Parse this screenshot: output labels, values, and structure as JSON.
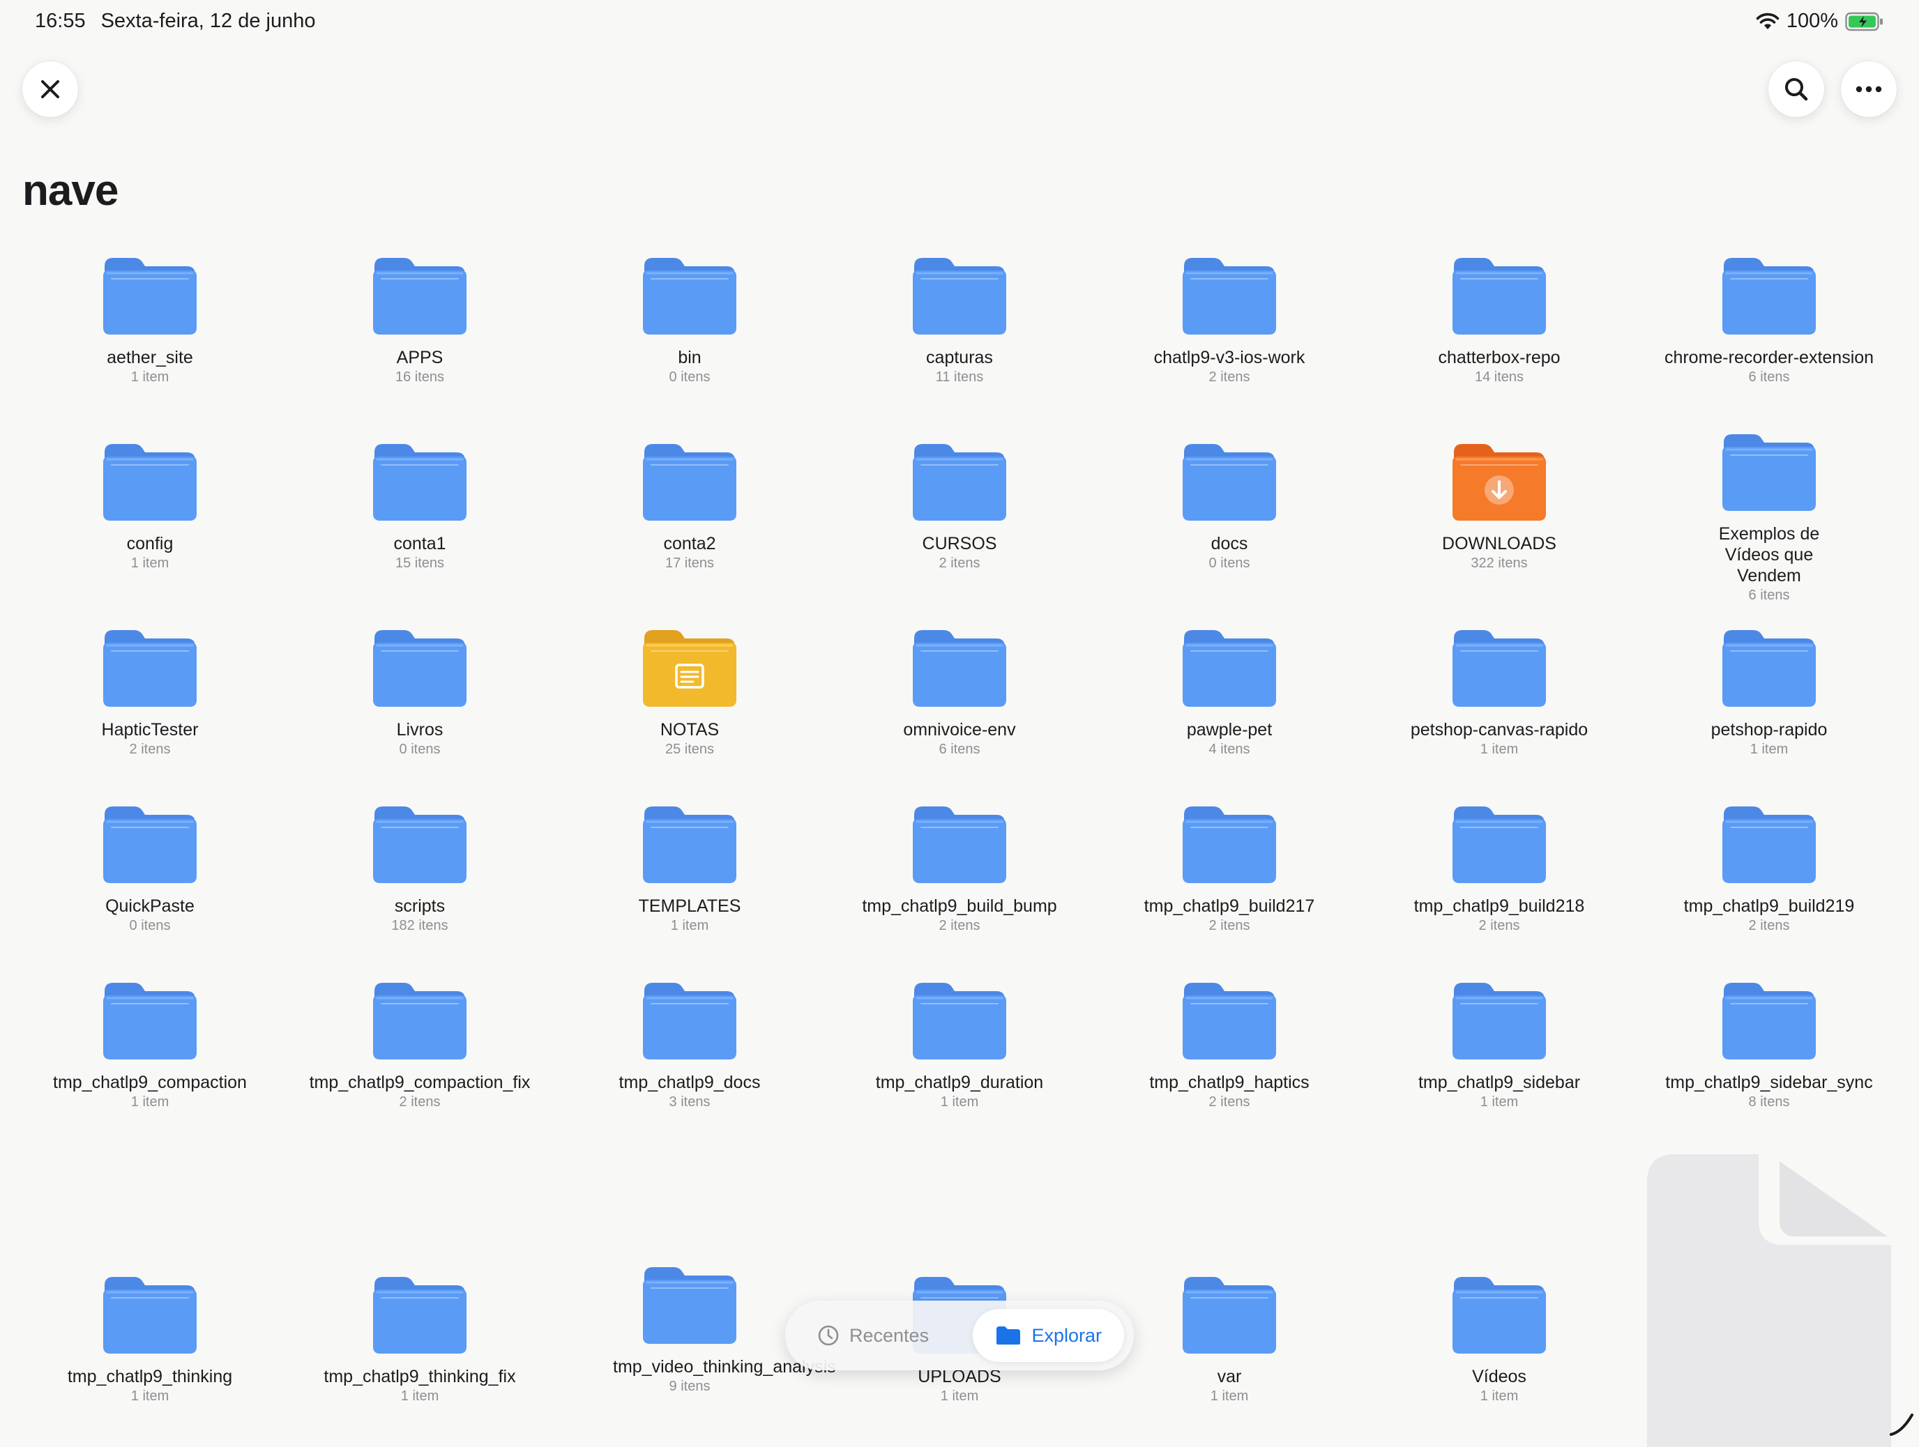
{
  "status": {
    "time": "16:55",
    "date": "Sexta-feira, 12 de junho",
    "battery": "100%"
  },
  "header": {
    "title": "nave",
    "close_icon": "close-icon",
    "search_icon": "search-icon",
    "more_icon": "more-icon"
  },
  "colors": {
    "folder_blue": "#5a9bf5",
    "folder_orange": "#f57a2a",
    "folder_yellow": "#f2b92c",
    "accent": "#1a73e8"
  },
  "folders": [
    {
      "name": "aether_site",
      "count": "1 item"
    },
    {
      "name": "APPS",
      "count": "16 itens"
    },
    {
      "name": "bin",
      "count": "0 itens"
    },
    {
      "name": "capturas",
      "count": "11 itens"
    },
    {
      "name": "chatlp9-v3-ios-work",
      "count": "2 itens"
    },
    {
      "name": "chatterbox-repo",
      "count": "14 itens"
    },
    {
      "name": "chrome-recorder-extension",
      "count": "6 itens"
    },
    {
      "name": "config",
      "count": "1 item"
    },
    {
      "name": "conta1",
      "count": "15 itens"
    },
    {
      "name": "conta2",
      "count": "17 itens"
    },
    {
      "name": "CURSOS",
      "count": "2 itens"
    },
    {
      "name": "docs",
      "count": "0 itens"
    },
    {
      "name": "DOWNLOADS",
      "count": "322 itens",
      "kind": "downloads"
    },
    {
      "name": "Exemplos de Vídeos que Vendem",
      "count": "6 itens"
    },
    {
      "name": "HapticTester",
      "count": "2 itens"
    },
    {
      "name": "Livros",
      "count": "0 itens"
    },
    {
      "name": "NOTAS",
      "count": "25 itens",
      "kind": "notes"
    },
    {
      "name": "omnivoice-env",
      "count": "6 itens"
    },
    {
      "name": "pawple-pet",
      "count": "4 itens"
    },
    {
      "name": "petshop-canvas-rapido",
      "count": "1 item"
    },
    {
      "name": "petshop-rapido",
      "count": "1 item"
    },
    {
      "name": "QuickPaste",
      "count": "0 itens"
    },
    {
      "name": "scripts",
      "count": "182 itens"
    },
    {
      "name": "TEMPLATES",
      "count": "1 item"
    },
    {
      "name": "tmp_chatlp9_build_bump",
      "count": "2 itens"
    },
    {
      "name": "tmp_chatlp9_build217",
      "count": "2 itens"
    },
    {
      "name": "tmp_chatlp9_build218",
      "count": "2 itens"
    },
    {
      "name": "tmp_chatlp9_build219",
      "count": "2 itens"
    },
    {
      "name": "tmp_chatlp9_compaction",
      "count": "1 item"
    },
    {
      "name": "tmp_chatlp9_compaction_fix",
      "count": "2 itens"
    },
    {
      "name": "tmp_chatlp9_docs",
      "count": "3 itens"
    },
    {
      "name": "tmp_chatlp9_duration",
      "count": "1 item"
    },
    {
      "name": "tmp_chatlp9_haptics",
      "count": "2 itens"
    },
    {
      "name": "tmp_chatlp9_sidebar",
      "count": "1 item"
    },
    {
      "name": "tmp_chatlp9_sidebar_sync",
      "count": "8 itens"
    },
    {
      "name": "tmp_chatlp9_thinking",
      "count": "1 item"
    },
    {
      "name": "tmp_chatlp9_thinking_fix",
      "count": "1 item"
    },
    {
      "name": "tmp_video_thinking_analysis",
      "count": "9 itens"
    },
    {
      "name": "UPLOADS",
      "count": "1 item"
    },
    {
      "name": "var",
      "count": "1 item"
    },
    {
      "name": "Vídeos",
      "count": "1 item"
    }
  ],
  "tabbar": {
    "recent_label": "Recentes",
    "explore_label": "Explorar"
  }
}
